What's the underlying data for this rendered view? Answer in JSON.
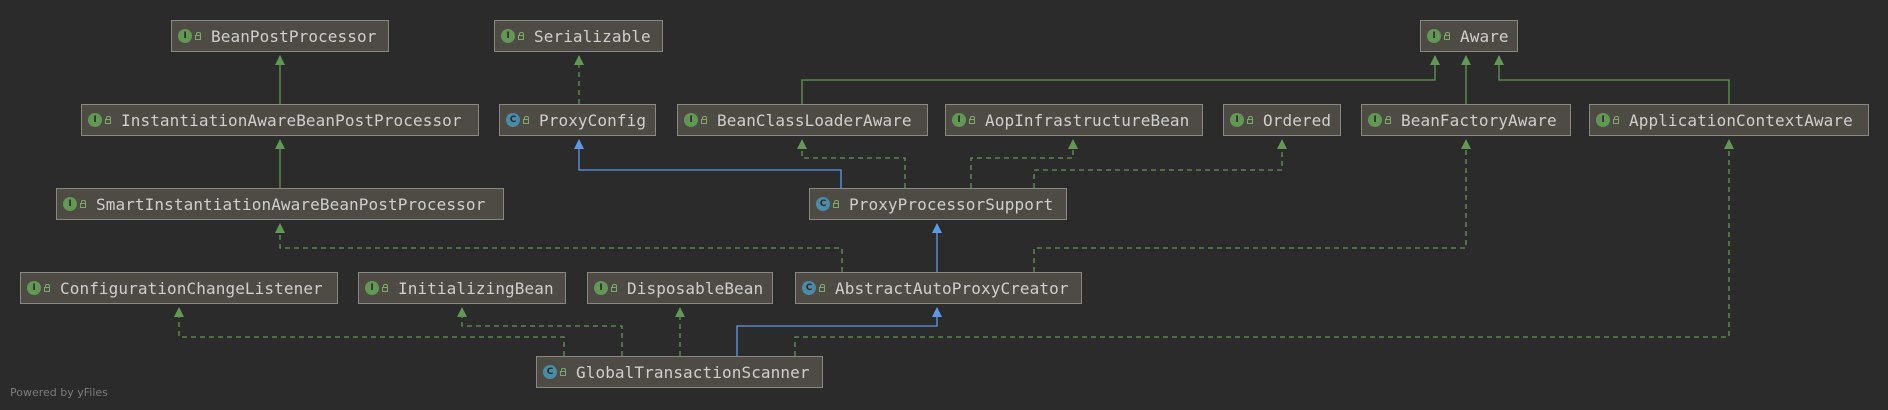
{
  "diagram": {
    "nodes": {
      "bean_post_processor": {
        "label": "BeanPostProcessor",
        "kind": "interface"
      },
      "serializable": {
        "label": "Serializable",
        "kind": "interface"
      },
      "aware": {
        "label": "Aware",
        "kind": "interface"
      },
      "instantiation_aware_bpp": {
        "label": "InstantiationAwareBeanPostProcessor",
        "kind": "interface"
      },
      "proxy_config": {
        "label": "ProxyConfig",
        "kind": "class"
      },
      "bean_class_loader_aware": {
        "label": "BeanClassLoaderAware",
        "kind": "interface"
      },
      "aop_infrastructure_bean": {
        "label": "AopInfrastructureBean",
        "kind": "interface"
      },
      "ordered": {
        "label": "Ordered",
        "kind": "interface"
      },
      "bean_factory_aware": {
        "label": "BeanFactoryAware",
        "kind": "interface"
      },
      "application_context_aware": {
        "label": "ApplicationContextAware",
        "kind": "interface"
      },
      "smart_instantiation_aware_bpp": {
        "label": "SmartInstantiationAwareBeanPostProcessor",
        "kind": "interface"
      },
      "proxy_processor_support": {
        "label": "ProxyProcessorSupport",
        "kind": "class"
      },
      "configuration_change_listener": {
        "label": "ConfigurationChangeListener",
        "kind": "interface"
      },
      "initializing_bean": {
        "label": "InitializingBean",
        "kind": "interface"
      },
      "disposable_bean": {
        "label": "DisposableBean",
        "kind": "interface"
      },
      "abstract_auto_proxy_creator": {
        "label": "AbstractAutoProxyCreator",
        "kind": "abstract-class"
      },
      "global_transaction_scanner": {
        "label": "GlobalTransactionScanner",
        "kind": "class"
      }
    },
    "edges": [
      {
        "from": "instantiation_aware_bpp",
        "to": "bean_post_processor",
        "type": "extends"
      },
      {
        "from": "smart_instantiation_aware_bpp",
        "to": "instantiation_aware_bpp",
        "type": "extends"
      },
      {
        "from": "proxy_config",
        "to": "serializable",
        "type": "implements"
      },
      {
        "from": "bean_class_loader_aware",
        "to": "aware",
        "type": "extends"
      },
      {
        "from": "bean_factory_aware",
        "to": "aware",
        "type": "extends"
      },
      {
        "from": "application_context_aware",
        "to": "aware",
        "type": "extends"
      },
      {
        "from": "proxy_processor_support",
        "to": "proxy_config",
        "type": "extends"
      },
      {
        "from": "proxy_processor_support",
        "to": "bean_class_loader_aware",
        "type": "implements"
      },
      {
        "from": "proxy_processor_support",
        "to": "aop_infrastructure_bean",
        "type": "implements"
      },
      {
        "from": "proxy_processor_support",
        "to": "ordered",
        "type": "implements"
      },
      {
        "from": "abstract_auto_proxy_creator",
        "to": "proxy_processor_support",
        "type": "extends"
      },
      {
        "from": "abstract_auto_proxy_creator",
        "to": "smart_instantiation_aware_bpp",
        "type": "implements"
      },
      {
        "from": "abstract_auto_proxy_creator",
        "to": "bean_factory_aware",
        "type": "implements"
      },
      {
        "from": "global_transaction_scanner",
        "to": "abstract_auto_proxy_creator",
        "type": "extends"
      },
      {
        "from": "global_transaction_scanner",
        "to": "configuration_change_listener",
        "type": "implements"
      },
      {
        "from": "global_transaction_scanner",
        "to": "initializing_bean",
        "type": "implements"
      },
      {
        "from": "global_transaction_scanner",
        "to": "disposable_bean",
        "type": "implements"
      },
      {
        "from": "global_transaction_scanner",
        "to": "application_context_aware",
        "type": "implements"
      }
    ]
  },
  "colors": {
    "background": "#2b2b2b",
    "node_fill": "#4e4b45",
    "node_border": "#8a8882",
    "interface_badge": "#629755",
    "class_badge": "#4b8ba8",
    "extends_edge": "#5c9ae6",
    "implements_edge": "#629755",
    "interface_extends_edge": "#629755"
  },
  "footer": {
    "text": "Powered by yFiles"
  }
}
